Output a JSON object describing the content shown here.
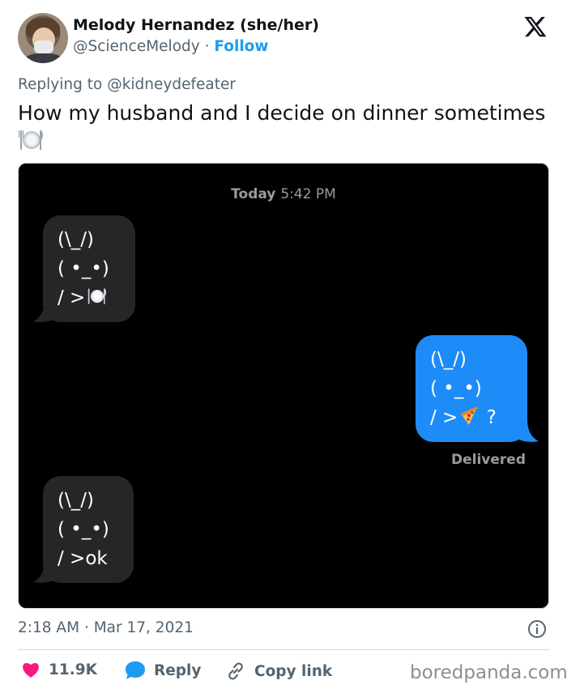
{
  "author": {
    "name": "Melody Hernandez (she/her)",
    "handle": "@ScienceMelody",
    "separator": "·",
    "follow_label": "Follow"
  },
  "reply_context": {
    "prefix": "Replying to",
    "mention": "@kidneydefeater"
  },
  "tweet": {
    "text": "How my husband and I decide on dinner sometimes",
    "emoji": "plate-fork-knife-icon"
  },
  "media": {
    "timestamp_day": "Today",
    "timestamp_time": "5:42 PM",
    "messages": [
      {
        "side": "left",
        "lines": [
          "(\\_/)",
          "( •_•)",
          "/ >"
        ],
        "emoji": "plate-fork-knife-icon"
      },
      {
        "side": "right",
        "lines": [
          "(\\_/)",
          "( •_•)",
          "/ >"
        ],
        "emoji": "pizza-icon",
        "suffix": "?"
      },
      {
        "side": "left",
        "lines": [
          "(\\_/)",
          "( •_•)",
          "/ >ok"
        ]
      }
    ],
    "status": "Delivered",
    "colors": {
      "background": "#000000",
      "gray_bubble": "#262628",
      "blue_bubble": "#1d8cf8"
    }
  },
  "meta": {
    "time": "2:18 AM",
    "separator": "·",
    "date": "Mar 17, 2021"
  },
  "actions": {
    "likes": "11.9K",
    "reply_label": "Reply",
    "copy_label": "Copy link"
  },
  "watermark": "boredpanda.com",
  "colors": {
    "accent": "#1d9bf0",
    "like": "#f91880",
    "muted": "#536471"
  }
}
